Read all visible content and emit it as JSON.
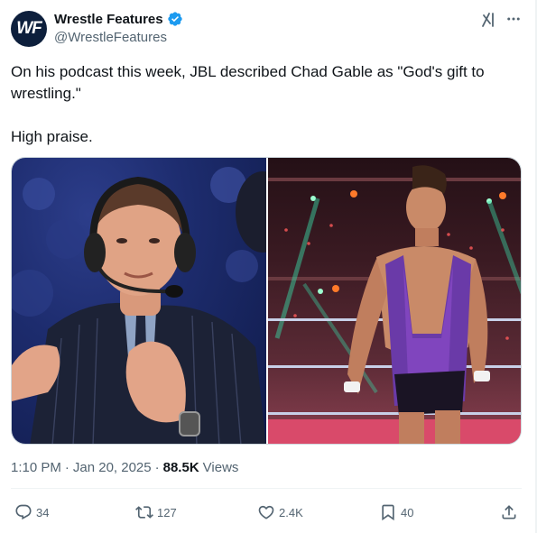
{
  "author": {
    "display_name": "Wrestle Features",
    "handle": "@WrestleFeatures",
    "avatar_initials": "WF",
    "avatar_color": "#0d1f3c",
    "verified": true,
    "verified_color": "#1d9bf0"
  },
  "tweet": {
    "text_line1": "On his podcast this week, JBL described Chad Gable as \"God's gift to wrestling.\"",
    "text_line2": "High praise."
  },
  "media": {
    "left_image": "jbl-commentary-photo",
    "right_image": "chad-gable-ring-photo"
  },
  "meta": {
    "time": "1:10 PM",
    "separator1": "·",
    "date": "Jan 20, 2025",
    "separator2": "·",
    "views_count": "88.5K",
    "views_label": "Views"
  },
  "actions": {
    "replies": "34",
    "reposts": "127",
    "likes": "2.4K",
    "bookmarks": "40"
  },
  "icons": {
    "reply": "reply-icon",
    "repost": "repost-icon",
    "like": "heart-icon",
    "bookmark": "bookmark-icon",
    "share": "share-icon",
    "grok": "grok-icon",
    "more": "more-icon"
  }
}
